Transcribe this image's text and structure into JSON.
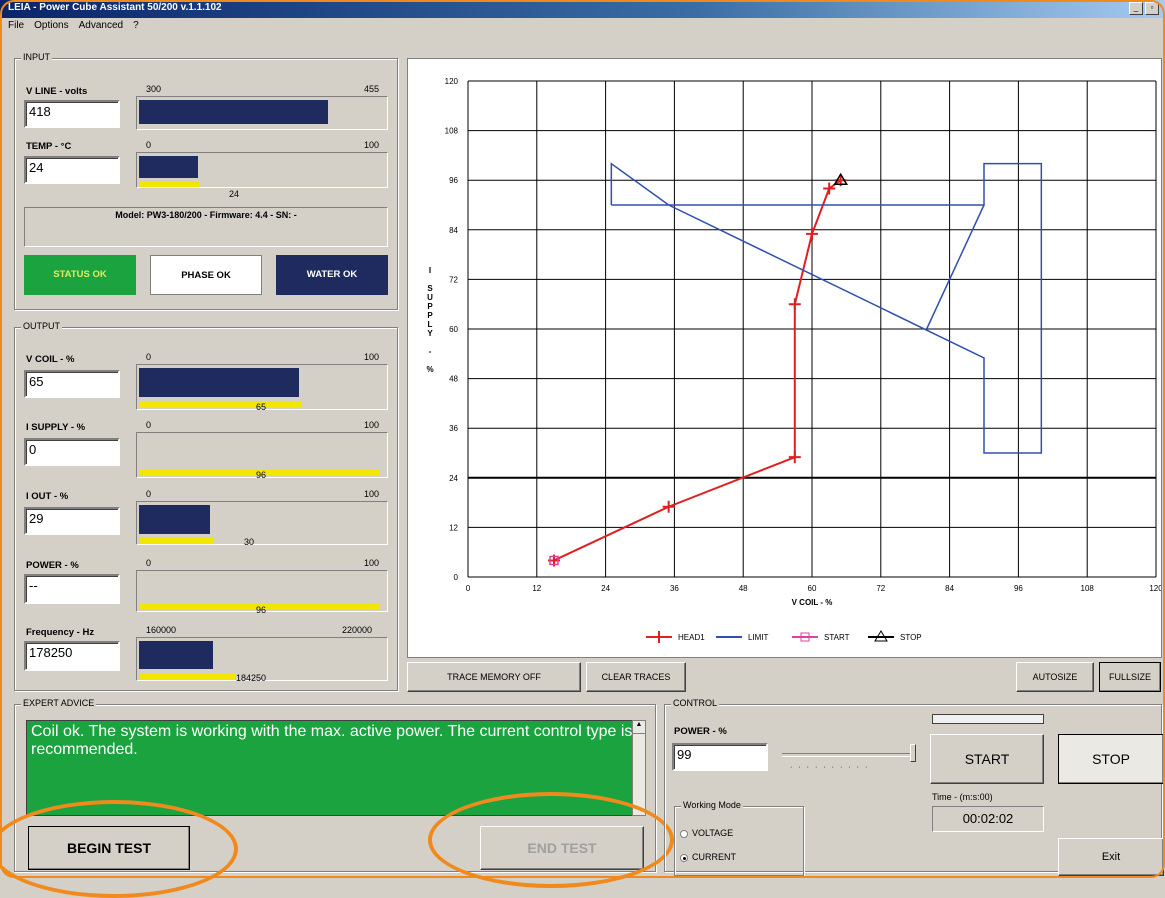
{
  "window": {
    "title": "LEIA - Power Cube Assistant 50/200 v.1.1.102"
  },
  "menu": [
    "File",
    "Options",
    "Advanced",
    "?"
  ],
  "input": {
    "group_label": "INPUT",
    "vline": {
      "label": "V LINE - volts",
      "value": "418",
      "min": "300",
      "max": "455",
      "level": 0.77
    },
    "temp": {
      "label": "TEMP - °C",
      "value": "24",
      "min": "0",
      "max": "100",
      "level": 0.24,
      "marker": "24"
    },
    "model_info": "Model: PW3-180/200 - Firmware: 4.4 - SN: -",
    "status": {
      "status_ok": "STATUS OK",
      "phase_ok": "PHASE OK",
      "water_ok": "WATER OK"
    }
  },
  "output": {
    "group_label": "OUTPUT",
    "vcoil": {
      "label": "V COIL - %",
      "value": "65",
      "min": "0",
      "max": "100",
      "level": 0.65,
      "marker": "65"
    },
    "isupply": {
      "label": "I SUPPLY - %",
      "value": "0",
      "min": "0",
      "max": "100",
      "level": 0,
      "marker": "96"
    },
    "iout": {
      "label": "I OUT - %",
      "value": "29",
      "min": "0",
      "max": "100",
      "level": 0.29,
      "marker": "30"
    },
    "power": {
      "label": "POWER - %",
      "value": "--",
      "min": "0",
      "max": "100",
      "level": 0,
      "marker": "96"
    },
    "frequency": {
      "label": "Frequency - Hz",
      "value": "178250",
      "min": "160000",
      "max": "220000",
      "level": 0.3,
      "marker": "184250"
    }
  },
  "chart_toolbar": {
    "trace_memory": "TRACE MEMORY OFF",
    "clear_traces": "CLEAR TRACES",
    "autosize": "AUTOSIZE",
    "fullsize": "FULLSIZE"
  },
  "expert": {
    "group_label": "EXPERT ADVICE",
    "text": "Coil ok. The system is working with the max. active power. The current control type is recommended.",
    "begin_test": "BEGIN TEST",
    "end_test": "END TEST"
  },
  "control": {
    "group_label": "CONTROL",
    "power_label": "POWER - %",
    "power_value": "99",
    "start": "START",
    "stop": "STOP",
    "time_label": "Time - (m:s:00)",
    "time_value": "00:02:02",
    "exit": "Exit",
    "working_mode_label": "Working Mode",
    "mode_voltage": "VOLTAGE",
    "mode_current": "CURRENT",
    "selected_mode": "CURRENT"
  },
  "colors": {
    "fill": "#1f2a5e",
    "marker": "#f2e600",
    "status_ok": "#1aa33f",
    "water_ok": "#1f2a5e",
    "head": "#e02020",
    "limit": "#3050b0",
    "highlight": "#f08a1c"
  },
  "chart_data": {
    "type": "line",
    "xlabel": "V COIL - %",
    "ylabel": "I SUPPLY - %",
    "xlim": [
      0,
      120
    ],
    "ylim": [
      0,
      120
    ],
    "xticks": [
      0,
      12,
      24,
      36,
      48,
      60,
      72,
      84,
      96,
      108,
      120
    ],
    "yticks": [
      0,
      12,
      24,
      36,
      48,
      60,
      72,
      84,
      96,
      108,
      120
    ],
    "grid": true,
    "legend_position": "bottom",
    "series": [
      {
        "name": "HEAD1",
        "color": "#e02020",
        "marker": "+",
        "x": [
          15,
          35,
          57,
          57,
          60,
          63,
          65
        ],
        "y": [
          4,
          17,
          29,
          66,
          83,
          94,
          96
        ]
      },
      {
        "name": "LIMIT",
        "color": "#3050b0",
        "marker": "none",
        "x": [
          25,
          25,
          35,
          90,
          90,
          100,
          100,
          90,
          90,
          25
        ],
        "y": [
          90,
          100,
          90,
          53,
          30,
          30,
          100,
          100,
          90,
          90
        ]
      },
      {
        "name": "LIMIT_inner",
        "color": "#3050b0",
        "marker": "none",
        "x": [
          80,
          90
        ],
        "y": [
          60,
          90
        ]
      },
      {
        "name": "START",
        "color": "#e040a0",
        "marker": "square",
        "x": [
          15
        ],
        "y": [
          4
        ]
      },
      {
        "name": "STOP",
        "color": "#000000",
        "marker": "triangle",
        "x": [
          65
        ],
        "y": [
          96
        ]
      }
    ]
  }
}
